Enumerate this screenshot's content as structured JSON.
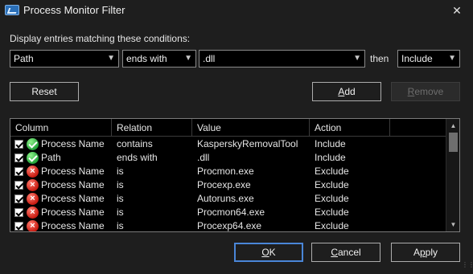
{
  "window": {
    "title": "Process Monitor Filter",
    "close_glyph": "✕"
  },
  "prompt": "Display entries matching these conditions:",
  "condition": {
    "column": "Path",
    "relation": "ends with",
    "value": ".dll",
    "then_label": "then",
    "action": "Include"
  },
  "buttons": {
    "reset": "Reset",
    "add_mnemonic": "A",
    "add_rest": "dd",
    "remove_mnemonic": "R",
    "remove_rest": "emove",
    "ok_mnemonic": "O",
    "ok_rest": "K",
    "cancel_mnemonic": "C",
    "cancel_rest": "ancel",
    "apply_pre": "A",
    "apply_mnemonic": "p",
    "apply_rest": "ply"
  },
  "table": {
    "headers": [
      "Column",
      "Relation",
      "Value",
      "Action"
    ],
    "rows": [
      {
        "status": "include",
        "column": "Process Name",
        "relation": "contains",
        "value": "KasperskyRemovalTool",
        "action": "Include"
      },
      {
        "status": "include",
        "column": "Path",
        "relation": "ends with",
        "value": ".dll",
        "action": "Include"
      },
      {
        "status": "exclude",
        "column": "Process Name",
        "relation": "is",
        "value": "Procmon.exe",
        "action": "Exclude"
      },
      {
        "status": "exclude",
        "column": "Process Name",
        "relation": "is",
        "value": "Procexp.exe",
        "action": "Exclude"
      },
      {
        "status": "exclude",
        "column": "Process Name",
        "relation": "is",
        "value": "Autoruns.exe",
        "action": "Exclude"
      },
      {
        "status": "exclude",
        "column": "Process Name",
        "relation": "is",
        "value": "Procmon64.exe",
        "action": "Exclude"
      },
      {
        "status": "exclude",
        "column": "Process Name",
        "relation": "is",
        "value": "Procexp64.exe",
        "action": "Exclude"
      }
    ]
  },
  "colors": {
    "background": "#1e1e1e",
    "field_background": "#000000",
    "default_button_border": "#4a86d8",
    "include_icon": "#23a33a",
    "exclude_icon": "#c81c12"
  },
  "icons": {
    "app": "process-monitor-icon",
    "include": "green-check-circle-icon",
    "exclude": "red-x-circle-icon",
    "dropdown": "chevron-down-icon"
  }
}
